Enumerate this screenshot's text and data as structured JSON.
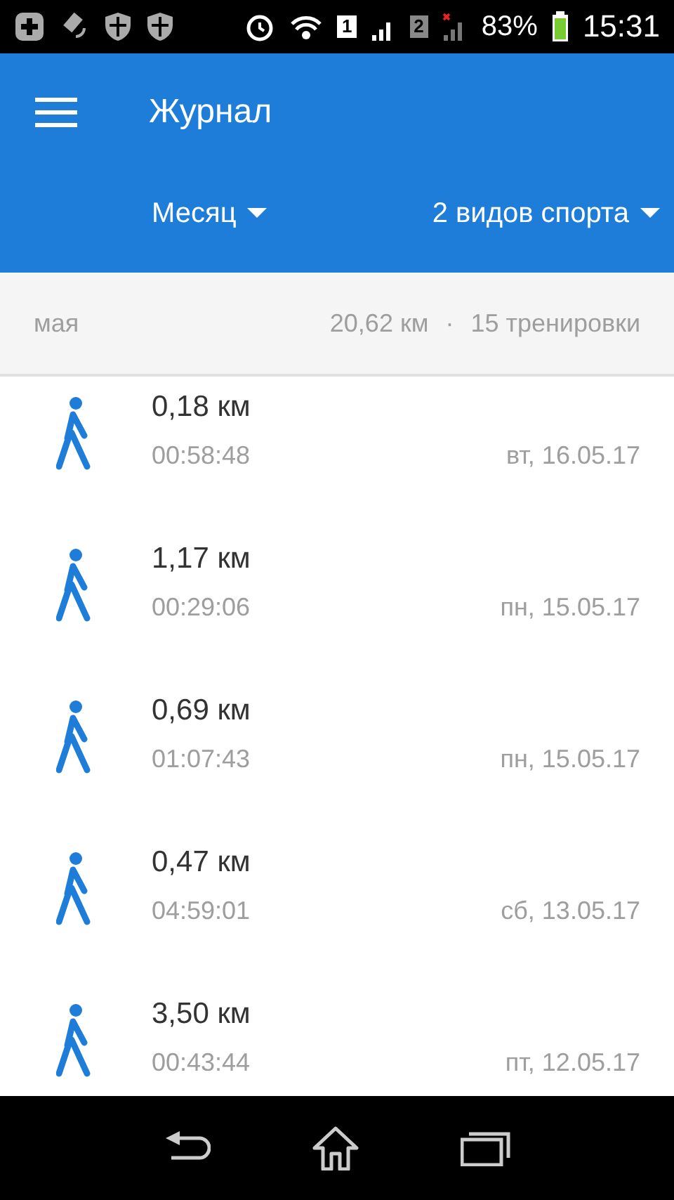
{
  "status_bar": {
    "sim_1": "1",
    "sim_2": "2",
    "battery": "83%",
    "time": "15:31"
  },
  "app_bar": {
    "title": "Журнал",
    "period": "Месяц",
    "sports": "2 видов спорта"
  },
  "summary": {
    "month": "мая",
    "distance": "20,62 км",
    "separator": "·",
    "workouts": "15 тренировки"
  },
  "workouts": [
    {
      "distance": "0,18 км",
      "duration": "00:58:48",
      "date": "вт, 16.05.17"
    },
    {
      "distance": "1,17 км",
      "duration": "00:29:06",
      "date": "пн, 15.05.17"
    },
    {
      "distance": "0,69 км",
      "duration": "01:07:43",
      "date": "пн, 15.05.17"
    },
    {
      "distance": "0,47 км",
      "duration": "04:59:01",
      "date": "сб, 13.05.17"
    },
    {
      "distance": "3,50 км",
      "duration": "00:43:44",
      "date": "пт, 12.05.17"
    }
  ]
}
